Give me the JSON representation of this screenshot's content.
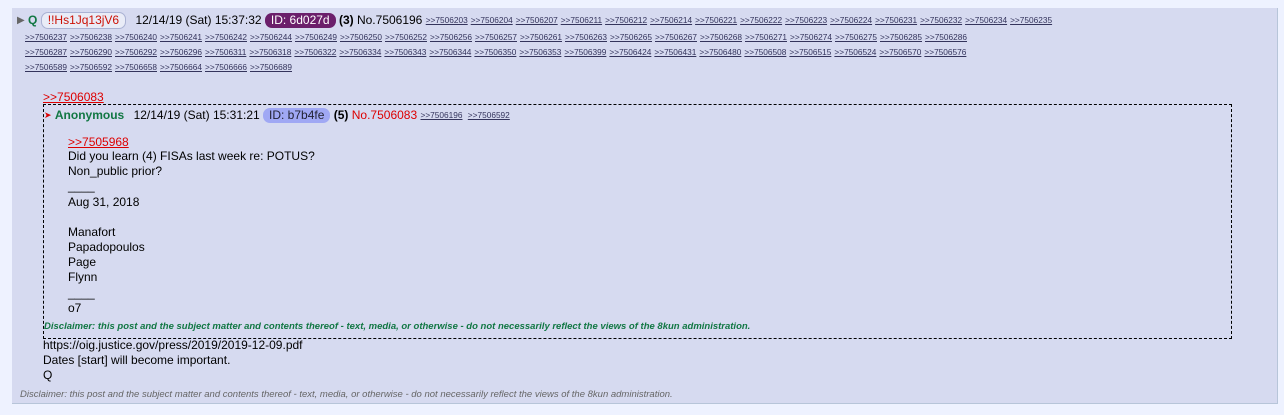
{
  "post": {
    "collapse_arrow": "▶",
    "name": "Q",
    "tripcode": "!!Hs1Jq13jV6",
    "date": "12/14/19 (Sat) 15:37:32",
    "id_label": "ID: 6d027d",
    "id_count": "(3)",
    "post_number": "No.7506196",
    "backlinks_row1": [
      ">>7506203",
      ">>7506204",
      ">>7506207",
      ">>7506211",
      ">>7506212",
      ">>7506214",
      ">>7506221",
      ">>7506222",
      ">>7506223",
      ">>7506224",
      ">>7506231",
      ">>7506232",
      ">>7506234",
      ">>7506235"
    ],
    "backlinks_row2": [
      ">>7506237",
      ">>7506238",
      ">>7506240",
      ">>7506241",
      ">>7506242",
      ">>7506244",
      ">>7506249",
      ">>7506250",
      ">>7506252",
      ">>7506256",
      ">>7506257",
      ">>7506261",
      ">>7506263",
      ">>7506265",
      ">>7506267",
      ">>7506268",
      ">>7506271",
      ">>7506274",
      ">>7506275",
      ">>7506285",
      ">>7506286"
    ],
    "backlinks_row3": [
      ">>7506287",
      ">>7506290",
      ">>7506292",
      ">>7506296",
      ">>7506311",
      ">>7506318",
      ">>7506322",
      ">>7506334",
      ">>7506343",
      ">>7506344",
      ">>7506350",
      ">>7506353",
      ">>7506399",
      ">>7506424",
      ">>7506431",
      ">>7506480",
      ">>7506508",
      ">>7506515",
      ">>7506524",
      ">>7506570",
      ">>7506576"
    ],
    "backlinks_row4": [
      ">>7506589",
      ">>7506592",
      ">>7506658",
      ">>7506664",
      ">>7506666",
      ">>7506689"
    ],
    "quote_link": ">>7506083",
    "body_lines": [
      "https://oig.justice.gov/press/2019/2019-12-09.pdf",
      "Dates [start] will become important.",
      "Q"
    ],
    "disclaimer": "Disclaimer: this post and the subject matter and contents thereof - text, media, or otherwise - do not necessarily reflect the views of the 8kun administration."
  },
  "quoted_post": {
    "arrow": "➤",
    "name": "Anonymous",
    "date": "12/14/19 (Sat) 15:31:21",
    "id_label": "ID: b7b4fe",
    "id_count": "(5)",
    "post_number": "No.7506083",
    "backlinks": [
      ">>7506196",
      ">>7506592"
    ],
    "quote_link": ">>7505968",
    "body_lines": [
      "Did you learn (4) FISAs last week re: POTUS?",
      "Non_public prior?",
      "____",
      "Aug 31, 2018",
      "",
      "Manafort",
      "Papadopoulos",
      "Page",
      "Flynn",
      "____",
      "o7"
    ],
    "disclaimer": "Disclaimer: this post and the subject matter and contents thereof - text, media, or otherwise - do not necessarily reflect the views of the 8kun administration."
  }
}
